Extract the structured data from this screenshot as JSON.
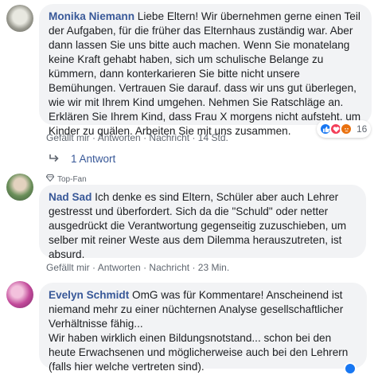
{
  "comments": [
    {
      "author": "Monika Niemann",
      "text": "Liebe Eltern! Wir übernehmen gerne einen Teil der Aufgaben, für die früher das Elternhaus zuständig war. Aber dann lassen Sie uns bitte auch machen. Wenn Sie monatelang keine Kraft gehabt haben, sich um schulische Belange zu kümmern, dann konterkarieren Sie bitte nicht unsere Bemühungen. Vertrauen Sie darauf. dass wir uns gut überlegen, wie wir mit Ihrem Kind umgehen. Nehmen Sie Ratschläge an. Erklären Sie Ihrem Kind, dass Frau X morgens nicht aufsteht, um Kinder zu quälen. Arbeiten Sie mit uns zusammen.",
      "like_label": "Gefällt mir",
      "reply_label": "Antworten",
      "message_label": "Nachricht",
      "time": "14 Std.",
      "reaction_count": "16",
      "replies_label": "1 Antwort"
    },
    {
      "badge": "Top-Fan",
      "author": "Nad Sad",
      "text": "Ich denke es sind Eltern, Schüler aber auch Lehrer gestresst und überfordert. Sich da die \"Schuld\" oder netter ausgedrückt die Verantwortung gegenseitig zuzuschieben, um selber mit reiner Weste aus dem Dilemma herauszutreten, ist absurd.",
      "like_label": "Gefällt mir",
      "reply_label": "Antworten",
      "message_label": "Nachricht",
      "time": "23 Min."
    },
    {
      "author": "Evelyn Schmidt",
      "text": "OmG was für Kommentare! Anscheinend ist niemand mehr zu einer nüchternen Analyse gesellschaftlicher Verhältnisse fähig...\nWir haben wirklich einen Bildungsnotstand... schon bei den heute Erwachsenen und möglicherweise auch bei den Lehrern (falls hier welche vertreten sind)."
    }
  ],
  "separator": "·",
  "icons": {
    "reply_arrow": "reply-arrow-icon",
    "badge": "diamond-icon",
    "like": "like-icon",
    "love": "love-icon",
    "angry": "angry-icon"
  },
  "colors": {
    "author": "#385898",
    "bubble": "#f2f3f5",
    "meta": "#606770"
  }
}
